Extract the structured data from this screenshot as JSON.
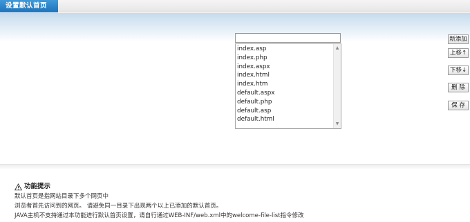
{
  "header": {
    "title": "设置默认首页"
  },
  "form": {
    "input_value": "",
    "files": [
      "index.asp",
      "index.php",
      "index.aspx",
      "index.html",
      "index.htm",
      "default.aspx",
      "default.php",
      "default.asp",
      "default.html"
    ]
  },
  "actions": {
    "add": "新添加",
    "move_up": "上移↑",
    "move_down": "下移↓",
    "delete": "删 除",
    "save": "保 存"
  },
  "tips": {
    "title": "功能提示",
    "icon": "warning-triangle-icon",
    "lines": [
      "默认首页是指网站目录下多个网页中",
      "浏览者首先访问到的网页。 请避免同一目录下出现两个以上已添加的默认首页。",
      "JAVA主机不支持通过本功能进行默认首页设置，请自行通过WEB-INF/web.xml中的welcome-file-list指令修改"
    ]
  }
}
